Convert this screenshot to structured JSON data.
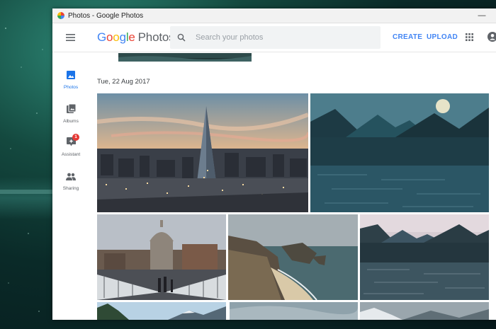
{
  "window": {
    "title": "Photos - Google Photos",
    "minimize_glyph": "—"
  },
  "header": {
    "logo": {
      "google_letters": [
        "G",
        "o",
        "o",
        "g",
        "l",
        "e"
      ],
      "product": "Photos"
    },
    "search": {
      "placeholder": "Search your photos"
    },
    "create_label": "CREATE",
    "upload_label": "UPLOAD",
    "icons": [
      "hamburger-menu-icon",
      "search-icon",
      "apps-grid-icon",
      "account-icon"
    ]
  },
  "sidebar": {
    "items": [
      {
        "label": "Photos",
        "icon": "photo-icon",
        "active": true
      },
      {
        "label": "Albums",
        "icon": "albums-icon",
        "active": false
      },
      {
        "label": "Assistant",
        "icon": "assistant-icon",
        "active": false,
        "badge": "1"
      },
      {
        "label": "Sharing",
        "icon": "sharing-icon",
        "active": false
      }
    ]
  },
  "main": {
    "date_header": "Tue, 22 Aug 2017",
    "photos": [
      {
        "subject": "london-skyline-shard-sunset"
      },
      {
        "subject": "mountain-lake-moon-night"
      },
      {
        "subject": "st-pauls-cathedral-millennium-bridge"
      },
      {
        "subject": "coastal-cliffs-beach-arch"
      },
      {
        "subject": "mountain-lake-twilight"
      }
    ]
  },
  "colors": {
    "accent": "#4285f4",
    "active_nav": "#1a73e8",
    "badge": "#e53935",
    "search_bg": "#f1f3f4"
  }
}
